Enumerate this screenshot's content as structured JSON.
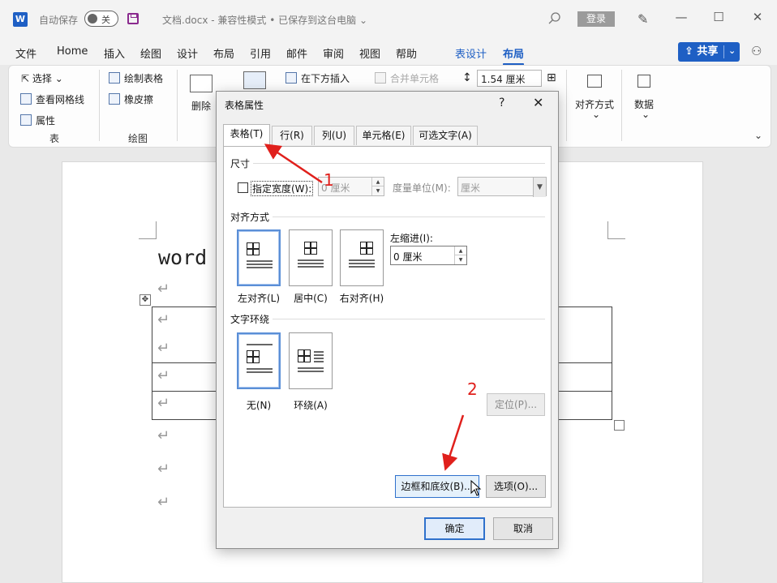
{
  "titlebar": {
    "logo": "W",
    "autosave_label": "自动保存",
    "autosave_state": "关",
    "doc_title": "文档.docx  -  兼容性模式 • 已保存到这台电脑 ⌄",
    "login": "登录",
    "min": "—",
    "max": "☐",
    "close": "✕"
  },
  "menu": {
    "items": [
      "文件",
      "Home",
      "插入",
      "绘图",
      "设计",
      "布局",
      "引用",
      "邮件",
      "审阅",
      "视图",
      "帮助"
    ],
    "context_items": [
      "表设计",
      "布局"
    ],
    "share": "共享"
  },
  "ribbon": {
    "select": "选择",
    "view_gridlines": "查看网格线",
    "properties": "属性",
    "draw_table": "绘制表格",
    "eraser": "橡皮擦",
    "delete": "删除",
    "insert_below": "在下方插入",
    "merge_cells": "合并单元格",
    "height_value": "1.54 厘米",
    "align": "对齐方式",
    "data": "数据",
    "group_table": "表",
    "group_draw": "绘图"
  },
  "document": {
    "heading_text": "word",
    "para_mark": "↵"
  },
  "dialog": {
    "title": "表格属性",
    "help": "?",
    "close": "✕",
    "tabs": [
      "表格(T)",
      "行(R)",
      "列(U)",
      "单元格(E)",
      "可选文字(A)"
    ],
    "size": {
      "section": "尺寸",
      "specify_width": "指定宽度(W):",
      "width_value": "0 厘米",
      "unit_label": "度量单位(M):",
      "unit_value": "厘米"
    },
    "alignment": {
      "section": "对齐方式",
      "options": [
        "左对齐(L)",
        "居中(C)",
        "右对齐(H)"
      ],
      "indent_label": "左缩进(I):",
      "indent_value": "0 厘米"
    },
    "wrapping": {
      "section": "文字环绕",
      "options": [
        "无(N)",
        "环绕(A)"
      ]
    },
    "buttons": {
      "position": "定位(P)...",
      "borders": "边框和底纹(B)...",
      "options": "选项(O)...",
      "ok": "确定",
      "cancel": "取消"
    }
  },
  "annotations": {
    "num1": "1",
    "num2": "2",
    "color": "#e0201c"
  }
}
